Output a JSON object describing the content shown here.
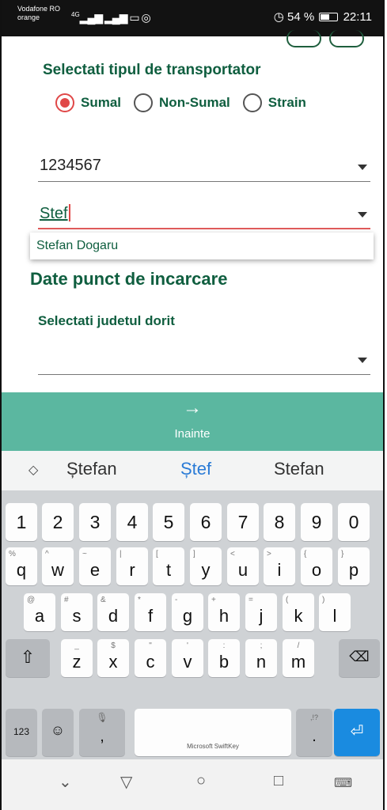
{
  "status_bar": {
    "carrier_line1": "Vodafone RO",
    "carrier_line2": "orange",
    "network": "4G",
    "battery": "54 %",
    "time": "22:11"
  },
  "form": {
    "title": "Selectati tipul de transportator",
    "options": [
      {
        "label": "Sumal",
        "checked": true
      },
      {
        "label": "Non-Sumal",
        "checked": false
      },
      {
        "label": "Strain",
        "checked": false
      }
    ],
    "id_value": "1234567",
    "name_value": "Stef",
    "autocomplete_item": "Stefan Dogaru",
    "load_heading": "Date punct de incarcare",
    "county_label": "Selectati judetul dorit",
    "county_value": ""
  },
  "next_button": {
    "icon": "arrow-right-icon",
    "label": "Inainte"
  },
  "suggestions": [
    "Ștefan",
    "Ștef",
    "Stefan"
  ],
  "keyboard": {
    "numbers": [
      "1",
      "2",
      "3",
      "4",
      "5",
      "6",
      "7",
      "8",
      "9",
      "0"
    ],
    "row1": [
      [
        "q",
        "%"
      ],
      [
        "w",
        "^"
      ],
      [
        "e",
        "~"
      ],
      [
        "r",
        "|"
      ],
      [
        "t",
        "["
      ],
      [
        "y",
        "]"
      ],
      [
        "u",
        "<"
      ],
      [
        "i",
        ">"
      ],
      [
        "o",
        "{"
      ],
      [
        "p",
        "}"
      ]
    ],
    "row2": [
      [
        "a",
        "@"
      ],
      [
        "s",
        "#"
      ],
      [
        "d",
        "&"
      ],
      [
        "f",
        "*"
      ],
      [
        "g",
        "-"
      ],
      [
        "h",
        "+"
      ],
      [
        "j",
        "="
      ],
      [
        "k",
        "("
      ],
      [
        "l",
        ")"
      ]
    ],
    "row3": [
      [
        "z",
        "_"
      ],
      [
        "x",
        "$"
      ],
      [
        "c",
        "\""
      ],
      [
        "v",
        "'"
      ],
      [
        "b",
        ":"
      ],
      [
        "n",
        ";"
      ],
      [
        "m",
        "/"
      ]
    ],
    "mode_label": "123",
    "comma": ",",
    "period": ".",
    "period_secondary": ",!?",
    "space_label": "Microsoft SwiftKey"
  },
  "colors": {
    "accent": "#0f5e3f",
    "radio": "#e04848",
    "button": "#5bb7a0",
    "enter": "#1a8be0"
  }
}
